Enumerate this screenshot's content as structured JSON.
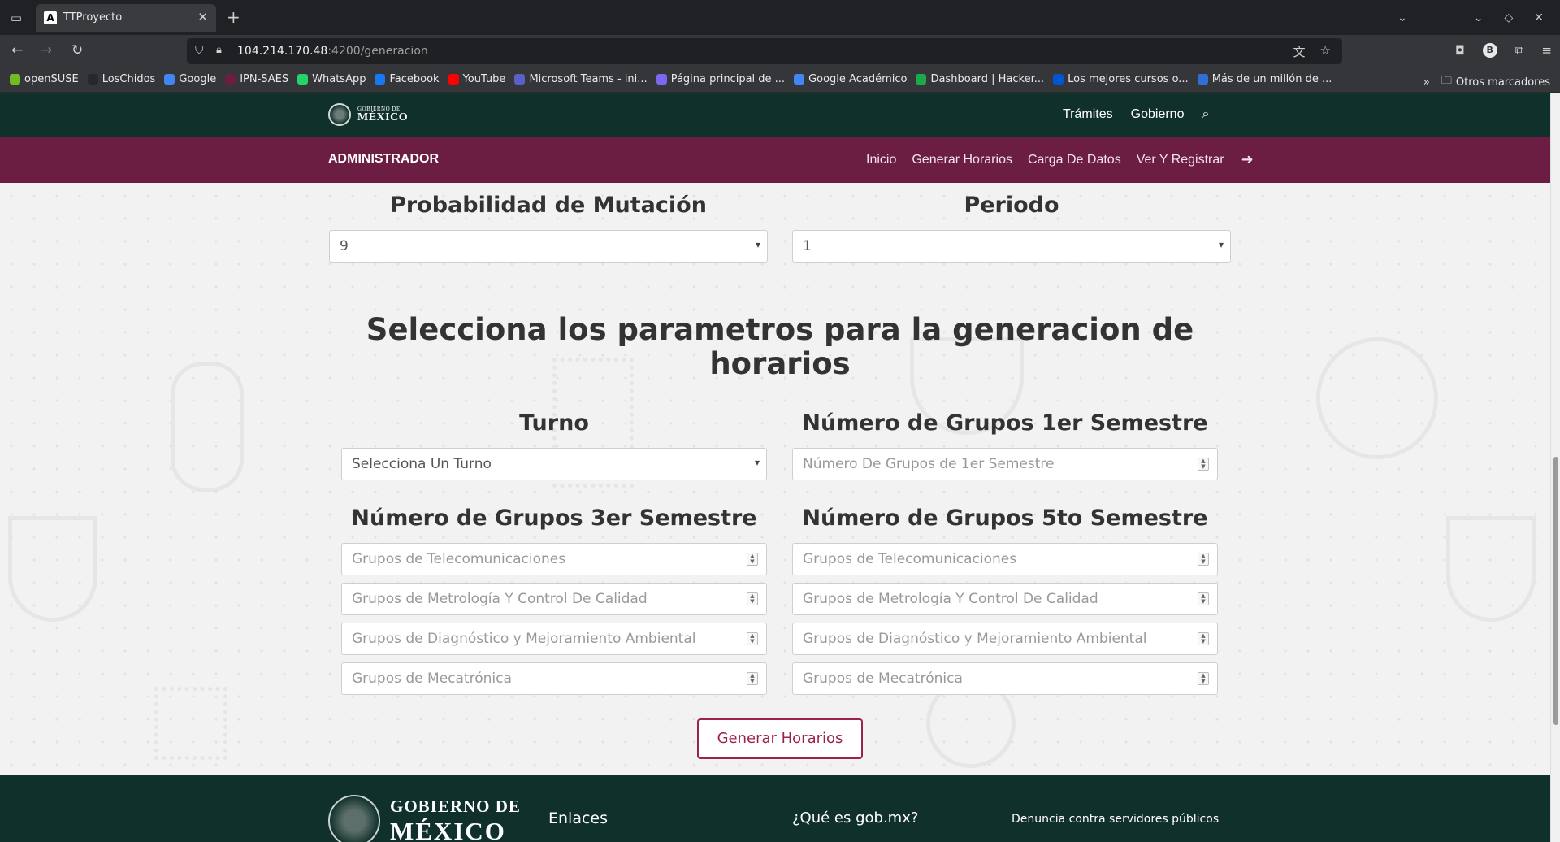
{
  "browser": {
    "tab_title": "TTProyecto",
    "tab_favicon": "A",
    "url_host": "104.214.170.48",
    "url_rest": ":4200/generacion",
    "profile_initial": "B",
    "bookmarks": [
      {
        "label": "openSUSE",
        "icon": "opensuse-icon",
        "color": "#73ba25"
      },
      {
        "label": "LosChidos",
        "icon": "github-icon",
        "color": "#24292e"
      },
      {
        "label": "Google",
        "icon": "google-icon",
        "color": "#4285f4"
      },
      {
        "label": "IPN-SAES",
        "icon": "ipn-icon",
        "color": "#6b1d42"
      },
      {
        "label": "WhatsApp",
        "icon": "whatsapp-icon",
        "color": "#25d366"
      },
      {
        "label": "Facebook",
        "icon": "facebook-icon",
        "color": "#1877f2"
      },
      {
        "label": "YouTube",
        "icon": "youtube-icon",
        "color": "#ff0000"
      },
      {
        "label": "Microsoft Teams - ini...",
        "icon": "teams-icon",
        "color": "#5b5fc7"
      },
      {
        "label": "Página principal de ...",
        "icon": "page-icon",
        "color": "#7b68ee"
      },
      {
        "label": "Google Académico",
        "icon": "scholar-icon",
        "color": "#4285f4"
      },
      {
        "label": "Dashboard | Hacker...",
        "icon": "hackerrank-icon",
        "color": "#1ba94c"
      },
      {
        "label": "Los mejores cursos o...",
        "icon": "coursera-icon",
        "color": "#0056d2"
      },
      {
        "label": "Más de un millón de ...",
        "icon": "mas-icon",
        "color": "#2f6fd6"
      }
    ],
    "other_bookmarks": "Otros marcadores"
  },
  "gob_header": {
    "logo_small": "GOBIERNO DE",
    "logo_big": "MÉXICO",
    "links": [
      "Trámites",
      "Gobierno"
    ]
  },
  "admin_bar": {
    "title": "ADMINISTRADOR",
    "nav": [
      "Inicio",
      "Generar Horarios",
      "Carga De Datos",
      "Ver Y Registrar"
    ]
  },
  "top_fields": {
    "mutation": {
      "label": "Probabilidad de Mutación",
      "value": "9"
    },
    "periodo": {
      "label": "Periodo",
      "value": "1"
    }
  },
  "heading": "Selecciona los parametros para la generacion de horarios",
  "turno": {
    "label": "Turno",
    "value": "Selecciona Un Turno"
  },
  "sem1": {
    "label": "Número de Grupos 1er Semestre",
    "placeholder": "Número De Grupos de 1er Semestre"
  },
  "sem3": {
    "label": "Número de Grupos 3er Semestre",
    "placeholders": [
      "Grupos de Telecomunicaciones",
      "Grupos de Metrología Y Control De Calidad",
      "Grupos de Diagnóstico y Mejoramiento Ambiental",
      "Grupos de Mecatrónica"
    ]
  },
  "sem5": {
    "label": "Número de Grupos 5to Semestre",
    "placeholders": [
      "Grupos de Telecomunicaciones",
      "Grupos de Metrología Y Control De Calidad",
      "Grupos de Diagnóstico y Mejoramiento Ambiental",
      "Grupos de Mecatrónica"
    ]
  },
  "generate_button": "Generar Horarios",
  "footer": {
    "logo_line1": "GOBIERNO DE",
    "logo_line2": "MÉXICO",
    "col1": "Enlaces",
    "col2": "¿Qué es gob.mx?",
    "col3": "Denuncia contra servidores públicos"
  },
  "colors": {
    "gob_green": "#10312b",
    "admin_maroon": "#6b1d42",
    "button_accent": "#9d2449"
  }
}
